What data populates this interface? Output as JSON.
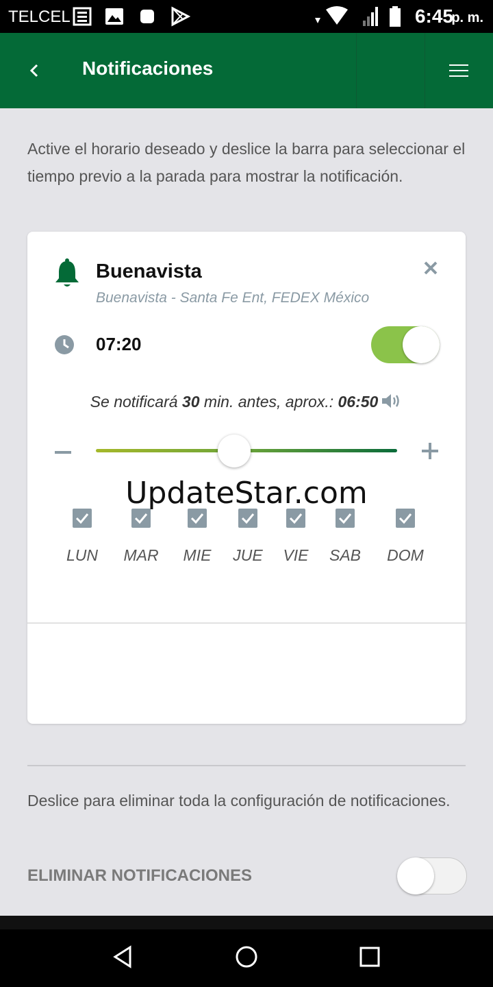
{
  "status_bar": {
    "carrier": "TELCEL",
    "time": "6:45",
    "ampm": "p. m.",
    "icons": [
      "news-icon",
      "image-icon",
      "app-icon",
      "play-store-icon",
      "wifi-icon",
      "signal-icon",
      "battery-icon"
    ]
  },
  "app_bar": {
    "title": "Notificaciones",
    "color": "#046a37"
  },
  "intro_text": "Active el horario deseado y deslice la barra para seleccionar el tiempo previo a la parada para mostrar la notificación.",
  "card": {
    "stop_name": "Buenavista",
    "route": "Buenavista - Santa Fe Ent, FEDEX México",
    "time": "07:20",
    "enabled": true,
    "notify_prefix": "Se notificará",
    "notify_minutes": "30",
    "notify_middle": "min. antes, aprox.:",
    "notify_time": "06:50",
    "slider_level": 0.46,
    "watermark": "UpdateStar.com",
    "days": [
      {
        "label": "LUN",
        "checked": true
      },
      {
        "label": "MAR",
        "checked": true
      },
      {
        "label": "MIE",
        "checked": true
      },
      {
        "label": "JUE",
        "checked": true
      },
      {
        "label": "VIE",
        "checked": true
      },
      {
        "label": "SAB",
        "checked": true
      },
      {
        "label": "DOM",
        "checked": true
      }
    ]
  },
  "delete": {
    "description": "Deslice para eliminar toda la configuración de notificaciones.",
    "label": "ELIMINAR NOTIFICACIONES",
    "enabled": false
  },
  "accent_color": "#8bc34a"
}
